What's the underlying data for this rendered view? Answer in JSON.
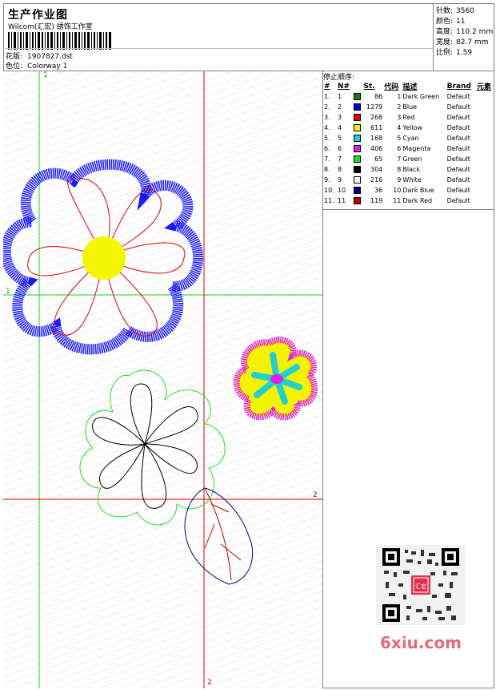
{
  "header": {
    "title": "生产作业图",
    "subtitle": "Wilcom(汇宏) 绣饰工作室",
    "design_label": "花版:",
    "design_value": "1907827.dst",
    "colorway_label": "色位:",
    "colorway_value": "Colorway 1"
  },
  "stats": {
    "stitches_label": "针数:",
    "stitches_value": "3560",
    "colors_label": "颜色:",
    "colors_value": "11",
    "height_label": "高度:",
    "height_value": "110.2 mm",
    "width_label": "宽度:",
    "width_value": "82.7 mm",
    "scale_label": "比例:",
    "scale_value": "1.59"
  },
  "panel": {
    "title": "停止顺序:",
    "columns": [
      "#",
      "N#",
      "St.",
      "代码",
      "描述",
      "Brand",
      "元素"
    ],
    "rows": [
      {
        "idx": "1.",
        "n": "1",
        "color": "#1a7a1a",
        "st": "86",
        "code": "1",
        "desc": "Dark Green",
        "brand": "Default"
      },
      {
        "idx": "2.",
        "n": "2",
        "color": "#0000e0",
        "st": "1279",
        "code": "2",
        "desc": "Blue",
        "brand": "Default"
      },
      {
        "idx": "3.",
        "n": "3",
        "color": "#e00000",
        "st": "268",
        "code": "3",
        "desc": "Red",
        "brand": "Default"
      },
      {
        "idx": "4.",
        "n": "4",
        "color": "#f0f000",
        "st": "611",
        "code": "4",
        "desc": "Yellow",
        "brand": "Default"
      },
      {
        "idx": "5.",
        "n": "5",
        "color": "#20d0d0",
        "st": "168",
        "code": "5",
        "desc": "Cyan",
        "brand": "Default"
      },
      {
        "idx": "6.",
        "n": "6",
        "color": "#e020e0",
        "st": "406",
        "code": "6",
        "desc": "Magenta",
        "brand": "Default"
      },
      {
        "idx": "7.",
        "n": "7",
        "color": "#20e020",
        "st": "65",
        "code": "7",
        "desc": "Green",
        "brand": "Default"
      },
      {
        "idx": "8.",
        "n": "8",
        "color": "#000000",
        "st": "304",
        "code": "8",
        "desc": "Black",
        "brand": "Default"
      },
      {
        "idx": "9.",
        "n": "9",
        "color": "#f4f4f4",
        "st": "216",
        "code": "9",
        "desc": "White",
        "brand": "Default"
      },
      {
        "idx": "10.",
        "n": "10",
        "color": "#000080",
        "st": "36",
        "code": "10",
        "desc": "Dark Blue",
        "brand": "Default"
      },
      {
        "idx": "11.",
        "n": "11",
        "color": "#c00000",
        "st": "119",
        "code": "11",
        "desc": "Dark Red",
        "brand": "Default"
      }
    ]
  },
  "canvas": {
    "axis_labels": {
      "green_top": "1",
      "green_left": "1",
      "red_right": "2",
      "red_bottom": "2"
    }
  },
  "watermark": {
    "text": "6xiu.com",
    "stamp_text": "汇宏"
  }
}
